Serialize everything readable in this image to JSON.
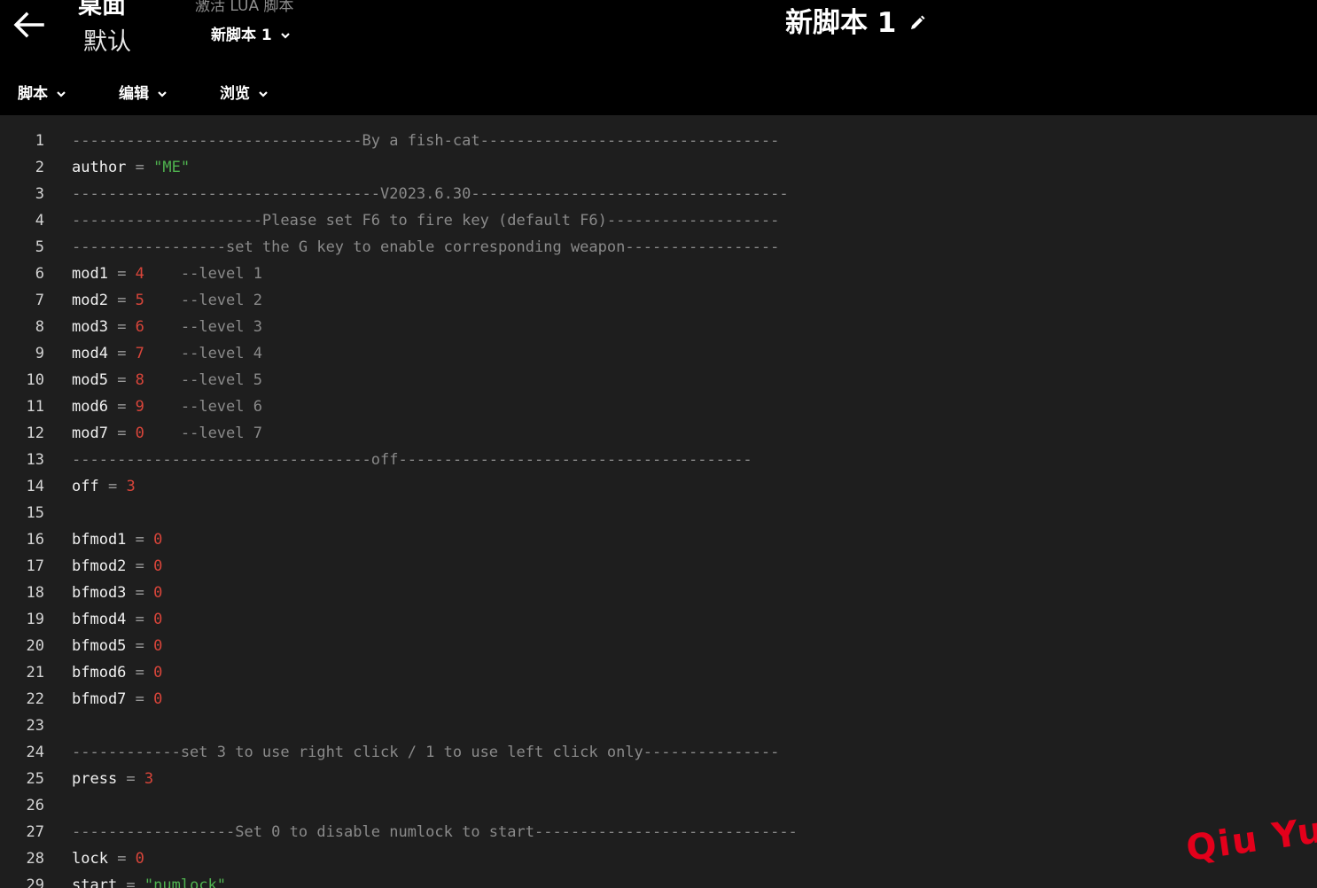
{
  "header": {
    "title": "桌面",
    "profile": "默认",
    "activate_label": "激活 LUA 脚本",
    "script_select": "新脚本 1",
    "script_title": "新脚本 1"
  },
  "menu": [
    {
      "label": "脚本"
    },
    {
      "label": "编辑"
    },
    {
      "label": "浏览"
    }
  ],
  "editor": {
    "lines": [
      {
        "n": "1",
        "t": [
          {
            "k": "c",
            "v": "--------------------------------By a fish-cat---------------------------------"
          }
        ]
      },
      {
        "n": "2",
        "t": [
          {
            "k": "id",
            "v": "author"
          },
          {
            "k": "o",
            "v": " = "
          },
          {
            "k": "s",
            "v": "\"ME\""
          }
        ]
      },
      {
        "n": "3",
        "t": [
          {
            "k": "c",
            "v": "----------------------------------V2023.6.30-----------------------------------"
          }
        ]
      },
      {
        "n": "4",
        "t": [
          {
            "k": "c",
            "v": "---------------------Please set F6 to fire key (default F6)-------------------"
          }
        ]
      },
      {
        "n": "5",
        "t": [
          {
            "k": "c",
            "v": "-----------------set the G key to enable corresponding weapon-----------------"
          }
        ]
      },
      {
        "n": "6",
        "t": [
          {
            "k": "id",
            "v": "mod1"
          },
          {
            "k": "o",
            "v": " = "
          },
          {
            "k": "n",
            "v": "4"
          },
          {
            "k": "c",
            "v": "    --level 1"
          }
        ]
      },
      {
        "n": "7",
        "t": [
          {
            "k": "id",
            "v": "mod2"
          },
          {
            "k": "o",
            "v": " = "
          },
          {
            "k": "n",
            "v": "5"
          },
          {
            "k": "c",
            "v": "    --level 2"
          }
        ]
      },
      {
        "n": "8",
        "t": [
          {
            "k": "id",
            "v": "mod3"
          },
          {
            "k": "o",
            "v": " = "
          },
          {
            "k": "n",
            "v": "6"
          },
          {
            "k": "c",
            "v": "    --level 3"
          }
        ]
      },
      {
        "n": "9",
        "t": [
          {
            "k": "id",
            "v": "mod4"
          },
          {
            "k": "o",
            "v": " = "
          },
          {
            "k": "n",
            "v": "7"
          },
          {
            "k": "c",
            "v": "    --level 4"
          }
        ]
      },
      {
        "n": "10",
        "t": [
          {
            "k": "id",
            "v": "mod5"
          },
          {
            "k": "o",
            "v": " = "
          },
          {
            "k": "n",
            "v": "8"
          },
          {
            "k": "c",
            "v": "    --level 5"
          }
        ]
      },
      {
        "n": "11",
        "t": [
          {
            "k": "id",
            "v": "mod6"
          },
          {
            "k": "o",
            "v": " = "
          },
          {
            "k": "n",
            "v": "9"
          },
          {
            "k": "c",
            "v": "    --level 6"
          }
        ]
      },
      {
        "n": "12",
        "t": [
          {
            "k": "id",
            "v": "mod7"
          },
          {
            "k": "o",
            "v": " = "
          },
          {
            "k": "n",
            "v": "0"
          },
          {
            "k": "c",
            "v": "    --level 7"
          }
        ]
      },
      {
        "n": "13",
        "t": [
          {
            "k": "c",
            "v": "---------------------------------off---------------------------------------"
          }
        ]
      },
      {
        "n": "14",
        "t": [
          {
            "k": "id",
            "v": "off"
          },
          {
            "k": "o",
            "v": " = "
          },
          {
            "k": "n",
            "v": "3"
          }
        ]
      },
      {
        "n": "15",
        "t": []
      },
      {
        "n": "16",
        "t": [
          {
            "k": "id",
            "v": "bfmod1"
          },
          {
            "k": "o",
            "v": " = "
          },
          {
            "k": "n",
            "v": "0"
          }
        ]
      },
      {
        "n": "17",
        "t": [
          {
            "k": "id",
            "v": "bfmod2"
          },
          {
            "k": "o",
            "v": " = "
          },
          {
            "k": "n",
            "v": "0"
          }
        ]
      },
      {
        "n": "18",
        "t": [
          {
            "k": "id",
            "v": "bfmod3"
          },
          {
            "k": "o",
            "v": " = "
          },
          {
            "k": "n",
            "v": "0"
          }
        ]
      },
      {
        "n": "19",
        "t": [
          {
            "k": "id",
            "v": "bfmod4"
          },
          {
            "k": "o",
            "v": " = "
          },
          {
            "k": "n",
            "v": "0"
          }
        ]
      },
      {
        "n": "20",
        "t": [
          {
            "k": "id",
            "v": "bfmod5"
          },
          {
            "k": "o",
            "v": " = "
          },
          {
            "k": "n",
            "v": "0"
          }
        ]
      },
      {
        "n": "21",
        "t": [
          {
            "k": "id",
            "v": "bfmod6"
          },
          {
            "k": "o",
            "v": " = "
          },
          {
            "k": "n",
            "v": "0"
          }
        ]
      },
      {
        "n": "22",
        "t": [
          {
            "k": "id",
            "v": "bfmod7"
          },
          {
            "k": "o",
            "v": " = "
          },
          {
            "k": "n",
            "v": "0"
          }
        ]
      },
      {
        "n": "23",
        "t": []
      },
      {
        "n": "24",
        "t": [
          {
            "k": "c",
            "v": "------------set 3 to use right click / 1 to use left click only---------------"
          }
        ]
      },
      {
        "n": "25",
        "t": [
          {
            "k": "id",
            "v": "press"
          },
          {
            "k": "o",
            "v": " = "
          },
          {
            "k": "n",
            "v": "3"
          }
        ]
      },
      {
        "n": "26",
        "t": []
      },
      {
        "n": "27",
        "t": [
          {
            "k": "c",
            "v": "------------------Set 0 to disable numlock to start-----------------------------"
          }
        ]
      },
      {
        "n": "28",
        "t": [
          {
            "k": "id",
            "v": "lock"
          },
          {
            "k": "o",
            "v": " = "
          },
          {
            "k": "n",
            "v": "0"
          }
        ]
      },
      {
        "n": "29",
        "t": [
          {
            "k": "id",
            "v": "start"
          },
          {
            "k": "o",
            "v": " = "
          },
          {
            "k": "s",
            "v": "\"numlock\""
          }
        ]
      }
    ]
  },
  "watermark": "Qiu Yue",
  "colors": {
    "header_bg": "#000000",
    "editor_bg": "#1e1e1e",
    "comment": "#8a8a8a",
    "number": "#d8453a",
    "string": "#4fb24f",
    "watermark": "#e3001b"
  },
  "icons": [
    "back-arrow-icon",
    "chevron-down-icon",
    "pencil-icon"
  ]
}
